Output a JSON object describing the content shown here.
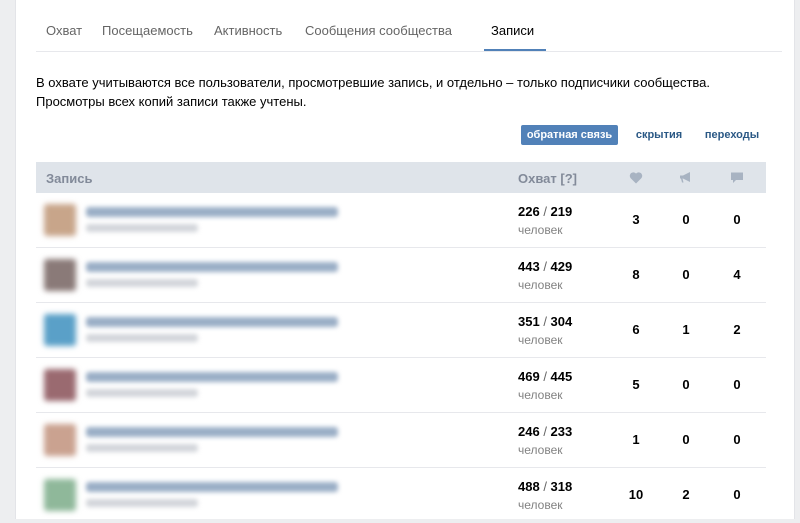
{
  "tabs": [
    {
      "label": "Охват"
    },
    {
      "label": "Посещаемость"
    },
    {
      "label": "Активность"
    },
    {
      "label": "Сообщения сообщества"
    },
    {
      "label": "Записи",
      "active": true
    }
  ],
  "intro": {
    "line1": "В охвате учитываются все пользователи, просмотревшие запись, и отдельно – только подписчики сообщества.",
    "line2": "Просмотры всех копий записи также учтены."
  },
  "view_buttons": {
    "feedback": "обратная связь",
    "hides": "скрытия",
    "clicks": "переходы"
  },
  "table": {
    "headers": {
      "post": "Запись",
      "reach": "Охват [?]",
      "likes_icon": "heart-icon",
      "reposts_icon": "megaphone-icon",
      "comments_icon": "comment-icon"
    },
    "unit": "человек",
    "rows": [
      {
        "reach_total": "226",
        "reach_subs": "219",
        "likes": "3",
        "reposts": "0",
        "comments": "0",
        "thumb_color": "#c8a58a"
      },
      {
        "reach_total": "443",
        "reach_subs": "429",
        "likes": "8",
        "reposts": "0",
        "comments": "4",
        "thumb_color": "#8a7a78"
      },
      {
        "reach_total": "351",
        "reach_subs": "304",
        "likes": "6",
        "reposts": "1",
        "comments": "2",
        "thumb_color": "#5aa0c8"
      },
      {
        "reach_total": "469",
        "reach_subs": "445",
        "likes": "5",
        "reposts": "0",
        "comments": "0",
        "thumb_color": "#9a6a70"
      },
      {
        "reach_total": "246",
        "reach_subs": "233",
        "likes": "1",
        "reposts": "0",
        "comments": "0",
        "thumb_color": "#caa290"
      },
      {
        "reach_total": "488",
        "reach_subs": "318",
        "likes": "10",
        "reposts": "2",
        "comments": "0",
        "thumb_color": "#8fb89a"
      }
    ]
  },
  "colors": {
    "accent": "#5181b8",
    "header_bg": "#dfe4ea",
    "link": "#2a5885"
  }
}
